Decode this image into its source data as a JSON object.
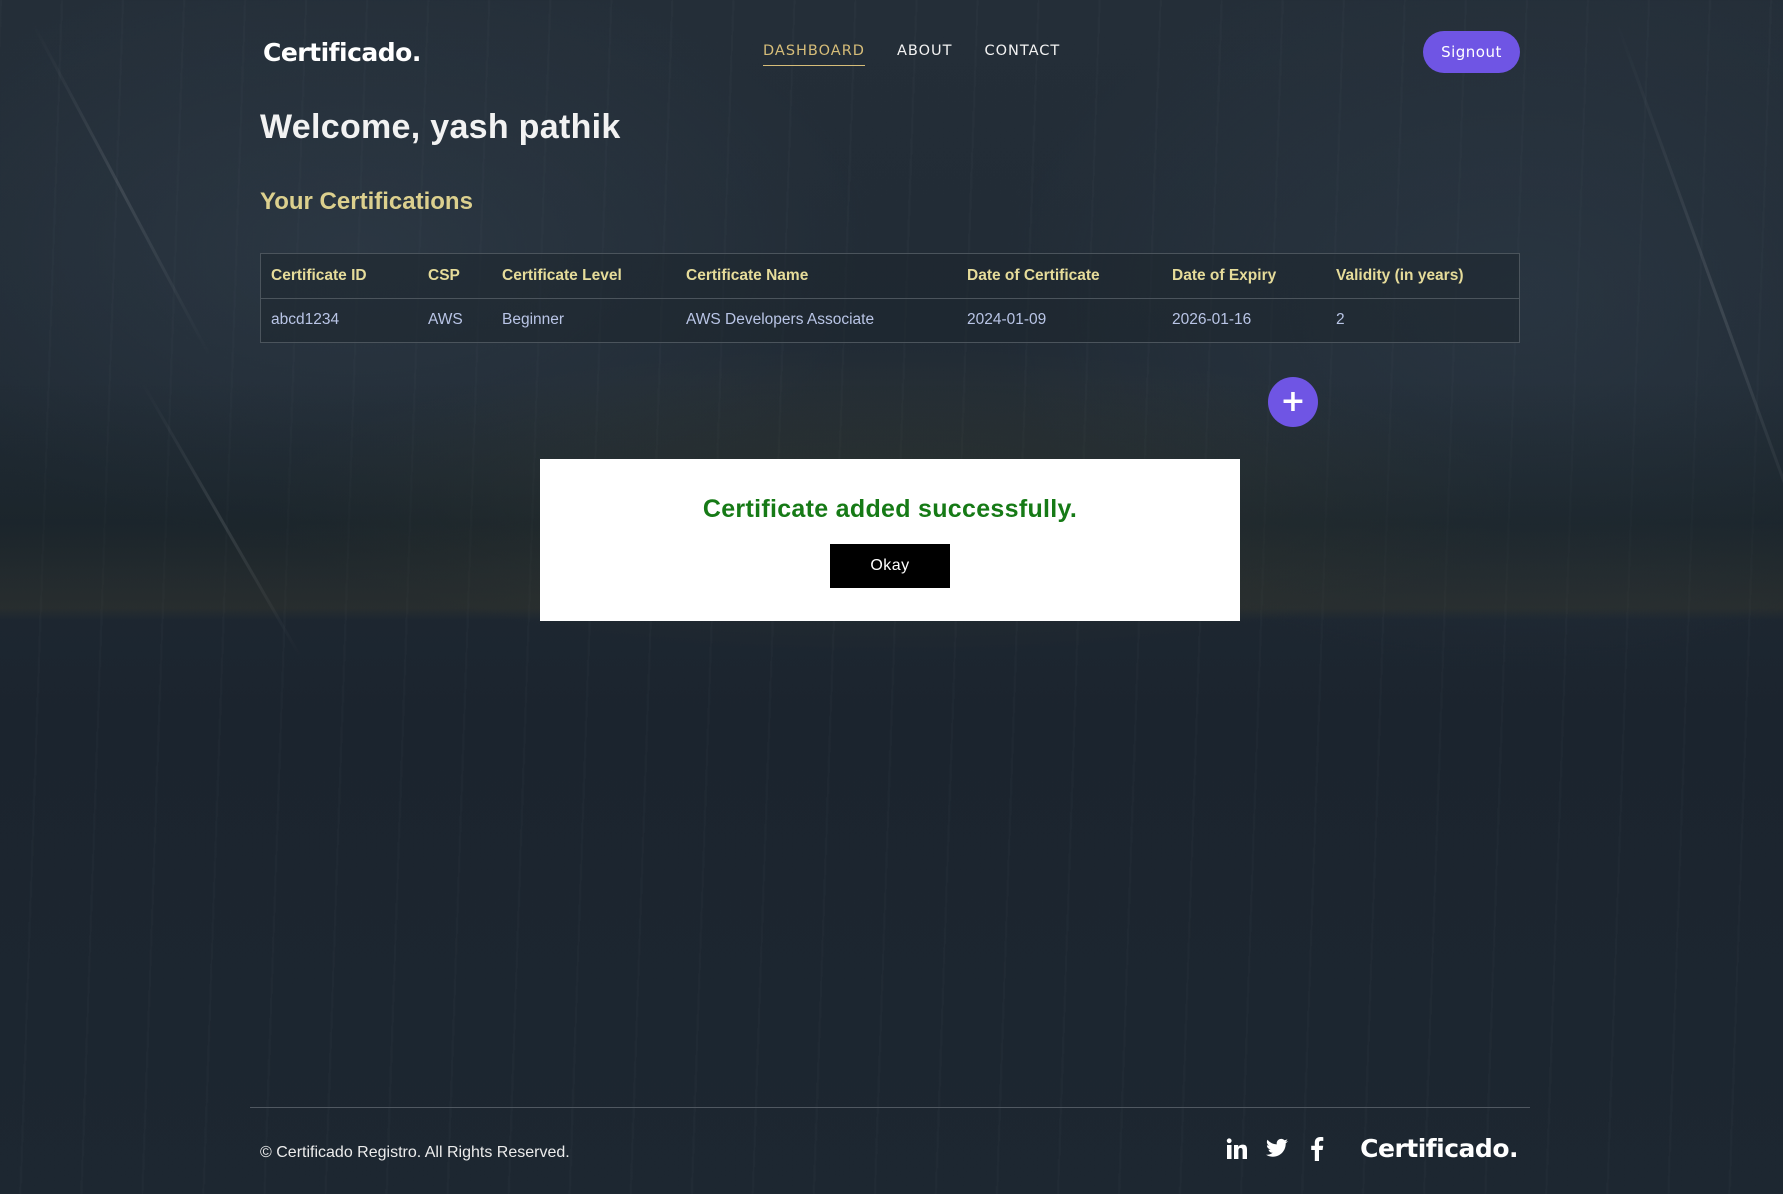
{
  "header": {
    "logo": "Certificado.",
    "nav": [
      {
        "label": "DASHBOARD",
        "active": true
      },
      {
        "label": "ABOUT",
        "active": false
      },
      {
        "label": "CONTACT",
        "active": false
      }
    ],
    "signout_label": "Signout"
  },
  "main": {
    "welcome": "Welcome, yash pathik",
    "section_title": "Your Certifications",
    "table": {
      "columns": [
        "Certificate ID",
        "CSP",
        "Certificate Level",
        "Certificate Name",
        "Date of Certificate",
        "Date of Expiry",
        "Validity (in years)"
      ],
      "rows": [
        [
          "abcd1234",
          "AWS",
          "Beginner",
          "AWS Developers Associate",
          "2024-01-09",
          "2026-01-16",
          "2"
        ]
      ]
    },
    "add_button_glyph": "+"
  },
  "modal": {
    "message": "Certificate added successfully.",
    "okay_label": "Okay"
  },
  "footer": {
    "copyright": "© Certificado Registro. All Rights Reserved.",
    "social_icons": [
      "linkedin-icon",
      "twitter-icon",
      "facebook-icon"
    ],
    "logo": "Certificado."
  },
  "colors": {
    "accent": "#6f55e4",
    "gold": "#dcd08e",
    "nav_active": "#d6bd79",
    "success": "#167a16",
    "table_text": "#b9c5e6"
  }
}
